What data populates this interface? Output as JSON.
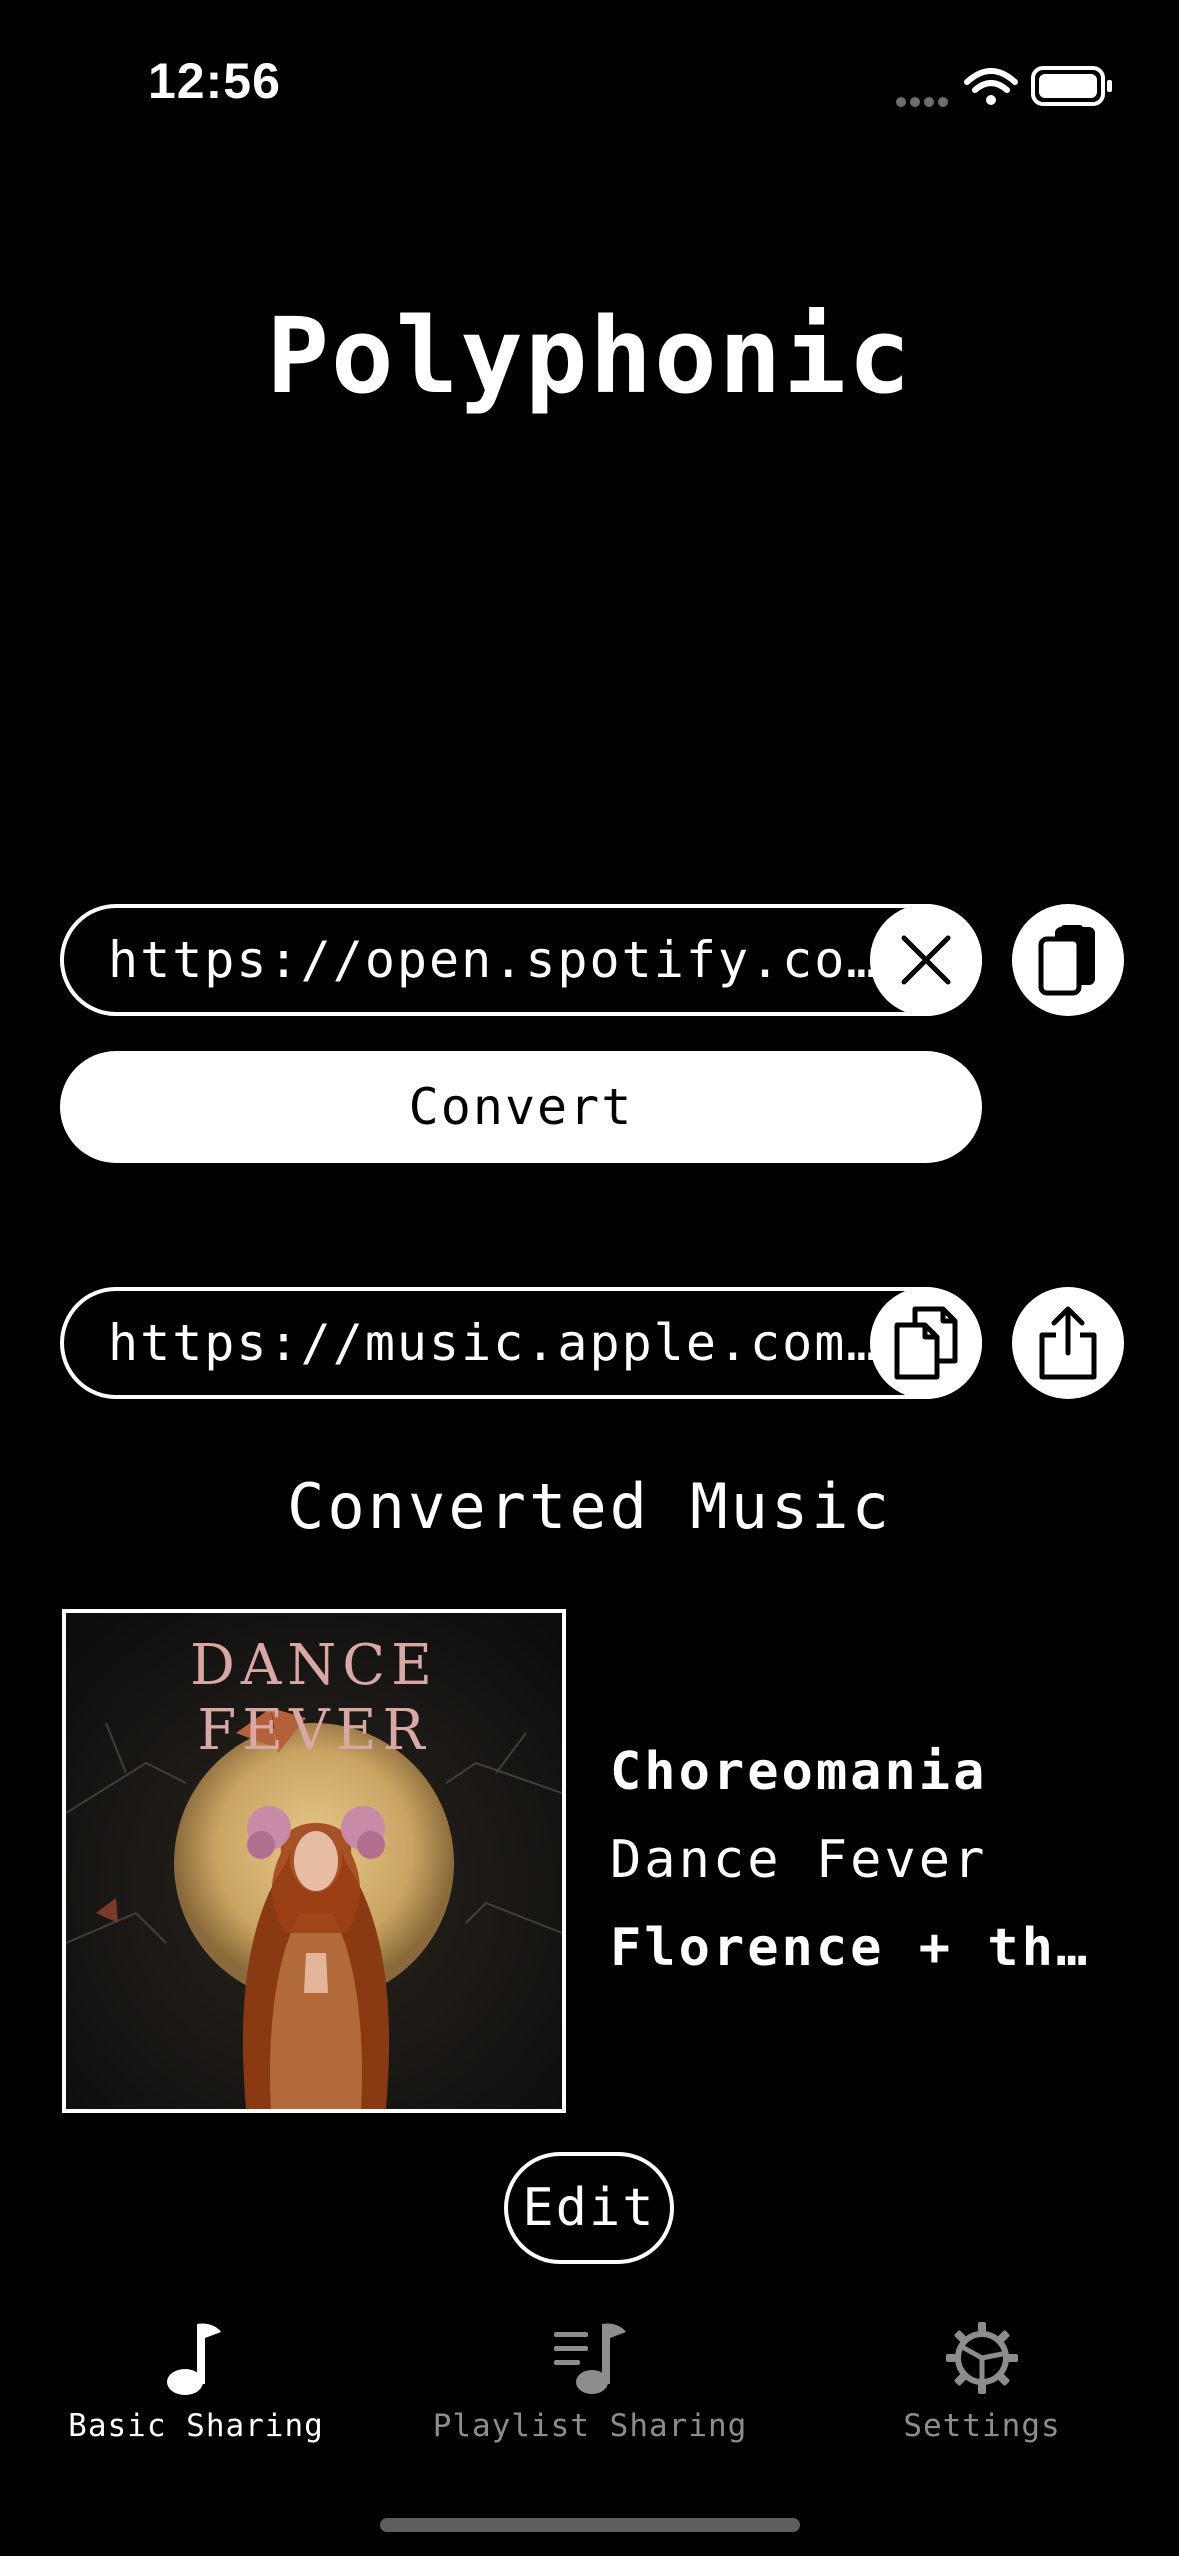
{
  "status_bar": {
    "time": "12:56",
    "icons": [
      "cellular-dots-icon",
      "wifi-icon",
      "battery-icon"
    ]
  },
  "app": {
    "title": "Polyphonic"
  },
  "source": {
    "url_value": "https://open.spotify.com…",
    "clear_icon": "close-icon",
    "paste_icon": "paste-icon"
  },
  "convert_label": "Convert",
  "result": {
    "url_value": "https://music.apple.com/…",
    "copy_icon": "copy-icon",
    "share_icon": "share-icon"
  },
  "converted": {
    "heading": "Converted Music",
    "artwork_text": "DANCE FEVER",
    "title": "Choreomania",
    "album": "Dance Fever",
    "artist": "Florence + the…"
  },
  "edit_label": "Edit",
  "tabs": [
    {
      "label": "Basic Sharing",
      "icon": "music-note-icon",
      "active": true
    },
    {
      "label": "Playlist Sharing",
      "icon": "playlist-icon",
      "active": false
    },
    {
      "label": "Settings",
      "icon": "gear-icon",
      "active": false
    }
  ],
  "colors": {
    "background": "#000000",
    "foreground": "#ffffff",
    "inactive_tab": "#8d8d8d"
  }
}
